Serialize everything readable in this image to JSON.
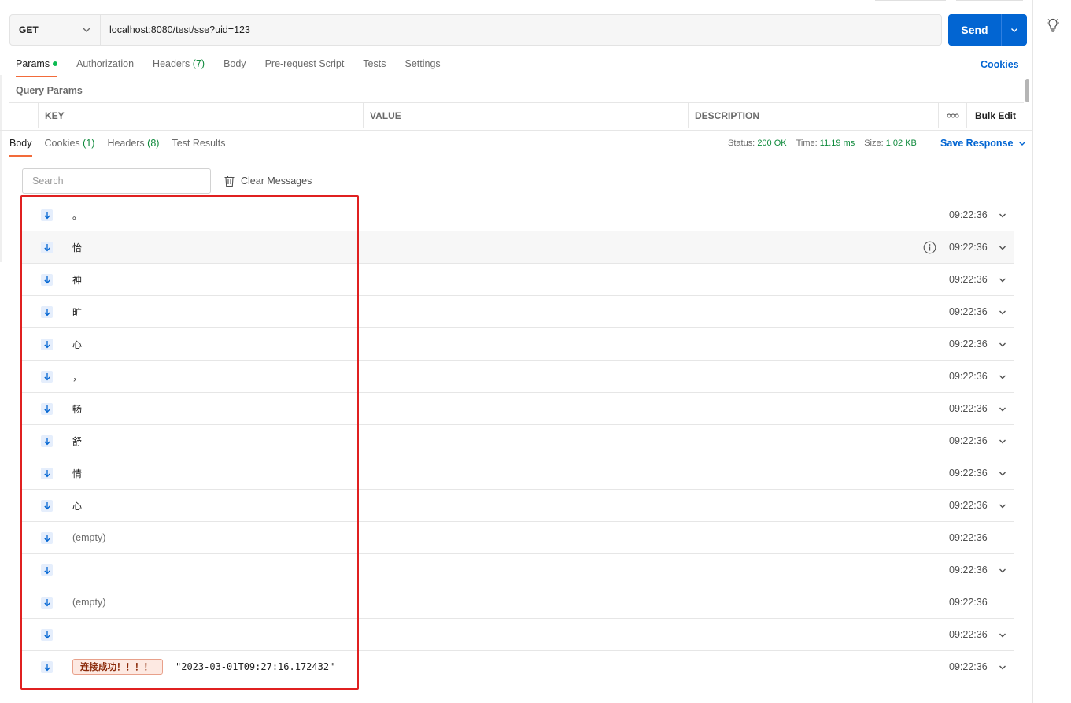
{
  "request": {
    "method": "GET",
    "url": "localhost:8080/test/sse?uid=123",
    "send_label": "Send"
  },
  "request_tabs": [
    {
      "label": "Params",
      "active": true
    },
    {
      "label": "Authorization"
    },
    {
      "label": "Headers",
      "count": "(7)"
    },
    {
      "label": "Body"
    },
    {
      "label": "Pre-request Script"
    },
    {
      "label": "Tests"
    },
    {
      "label": "Settings"
    }
  ],
  "cookies_link": "Cookies",
  "query_params": {
    "title": "Query Params",
    "columns": [
      "KEY",
      "VALUE",
      "DESCRIPTION"
    ],
    "more": "ooo",
    "bulk_edit": "Bulk Edit"
  },
  "response_tabs": [
    {
      "label": "Body",
      "active": true
    },
    {
      "label": "Cookies",
      "count": "(1)"
    },
    {
      "label": "Headers",
      "count": "(8)"
    },
    {
      "label": "Test Results"
    }
  ],
  "response_meta": {
    "status_label": "Status:",
    "status": "200 OK",
    "time_label": "Time:",
    "time": "11.19 ms",
    "size_label": "Size:",
    "size": "1.02 KB",
    "save_response": "Save Response"
  },
  "search_placeholder": "Search",
  "clear_messages": "Clear Messages",
  "messages": [
    {
      "text": "。",
      "time": "09:22:36"
    },
    {
      "text": "怡",
      "time": "09:22:36"
    },
    {
      "text": "神",
      "time": "09:22:36"
    },
    {
      "text": "旷",
      "time": "09:22:36"
    },
    {
      "text": "心",
      "time": "09:22:36"
    },
    {
      "text": "，",
      "time": "09:22:36"
    },
    {
      "text": "畅",
      "time": "09:22:36"
    },
    {
      "text": "舒",
      "time": "09:22:36"
    },
    {
      "text": "情",
      "time": "09:22:36"
    },
    {
      "text": "心",
      "time": "09:22:36"
    },
    {
      "text": "(empty)",
      "time": "09:22:36"
    },
    {
      "text": "",
      "time": "09:22:36"
    },
    {
      "text": "(empty)",
      "time": "09:22:36"
    },
    {
      "text": "",
      "time": "09:22:36"
    },
    {
      "badge": "连接成功！！！！",
      "json": "\"2023-03-01T09:27:16.172432\"",
      "time": "09:22:36"
    }
  ],
  "colors": {
    "accent": "#0265d2",
    "tab_underline": "#f26b3a",
    "status_green": "#0f8a3c",
    "highlight_red": "#e02020"
  }
}
